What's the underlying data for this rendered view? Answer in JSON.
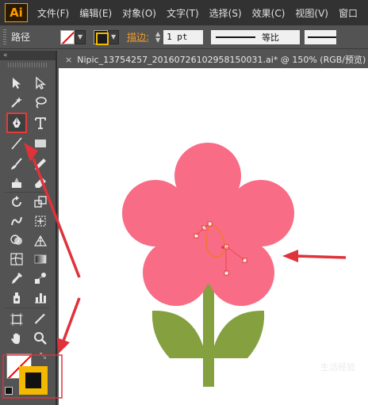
{
  "app": {
    "logo_text": "Ai"
  },
  "menu": [
    "文件(F)",
    "编辑(E)",
    "对象(O)",
    "文字(T)",
    "选择(S)",
    "效果(C)",
    "视图(V)",
    "窗口"
  ],
  "control_bar": {
    "selection_label": "路径",
    "stroke_label": "描边:",
    "stroke_weight": "1 pt",
    "profile_label": "等比"
  },
  "document": {
    "tab_title": "Nipic_13754257_20160726102958150031.ai* @ 150% (RGB/预览)"
  },
  "colors": {
    "petal": "#f96c85",
    "stem": "#84a03f",
    "stroke_swatch": "#f5b800",
    "arrow": "#e0323a"
  },
  "watermark": "生活经验"
}
